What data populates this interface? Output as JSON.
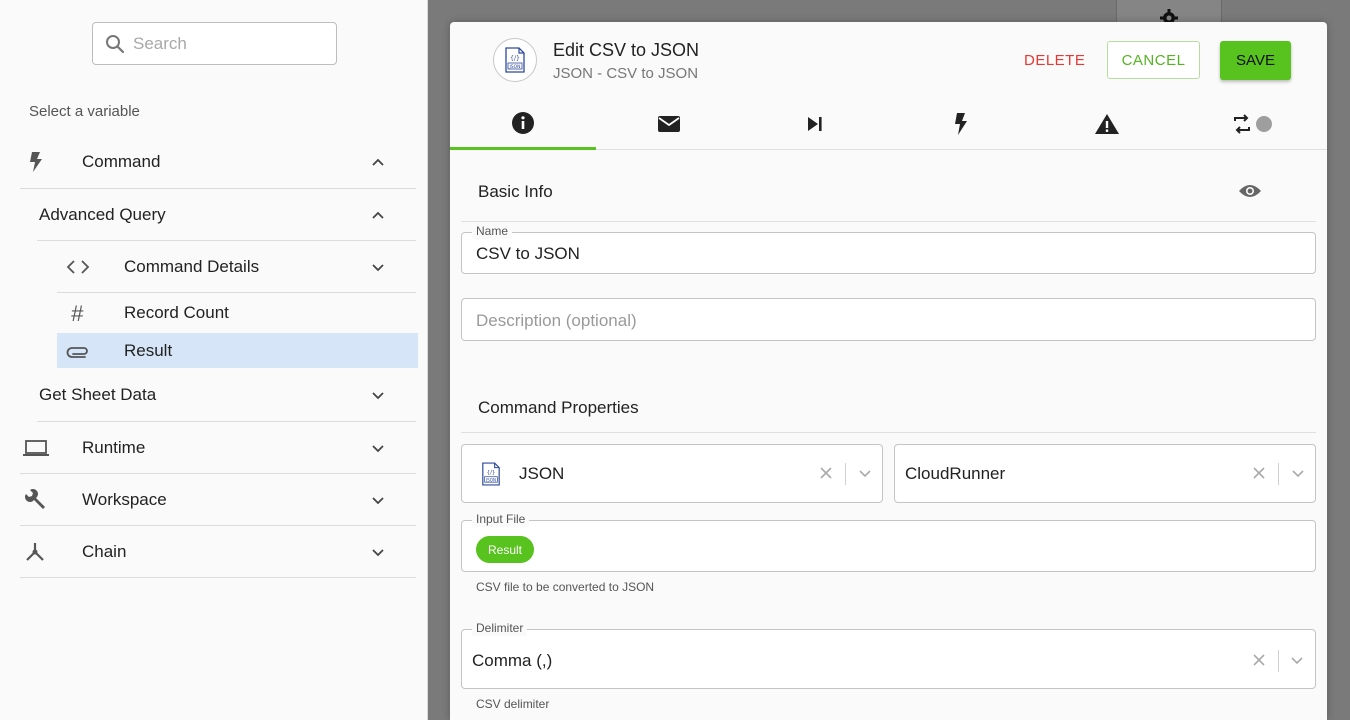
{
  "sidebar": {
    "search_placeholder": "Search",
    "select_label": "Select a variable",
    "items": [
      {
        "label": "Command",
        "icon": "lightning-icon"
      },
      {
        "label": "Advanced Query"
      },
      {
        "label": "Command Details",
        "icon": "code-icon"
      },
      {
        "label": "Record Count",
        "icon": "hash-icon"
      },
      {
        "label": "Result",
        "icon": "paperclip-icon",
        "selected": true
      },
      {
        "label": "Get Sheet Data"
      },
      {
        "label": "Runtime",
        "icon": "laptop-icon"
      },
      {
        "label": "Workspace",
        "icon": "wrench-icon"
      },
      {
        "label": "Chain",
        "icon": "fork-icon"
      }
    ]
  },
  "dialog": {
    "title": "Edit CSV to JSON",
    "subtitle": "JSON - CSV to JSON",
    "buttons": {
      "delete": "DELETE",
      "cancel": "CANCEL",
      "save": "SAVE"
    },
    "tabs": [
      {
        "icon": "info-icon",
        "active": true
      },
      {
        "icon": "mail-icon"
      },
      {
        "icon": "skip-next-icon"
      },
      {
        "icon": "lightning-icon"
      },
      {
        "icon": "warning-icon"
      },
      {
        "icon": "repeat-toggle-icon"
      }
    ],
    "basic_info": {
      "title": "Basic Info",
      "name_label": "Name",
      "name_value": "CSV to JSON",
      "description_placeholder": "Description (optional)"
    },
    "command_properties": {
      "title": "Command Properties",
      "connector_value": "JSON",
      "runner_value": "CloudRunner",
      "input_file_label": "Input File",
      "input_file_chip": "Result",
      "input_file_helper": "CSV file to be converted to JSON",
      "delimiter_label": "Delimiter",
      "delimiter_value": "Comma (,)",
      "delimiter_helper": "CSV delimiter"
    }
  },
  "colors": {
    "accent": "#58c21e",
    "danger": "#e53935",
    "selected_row": "#d6e6f8"
  }
}
